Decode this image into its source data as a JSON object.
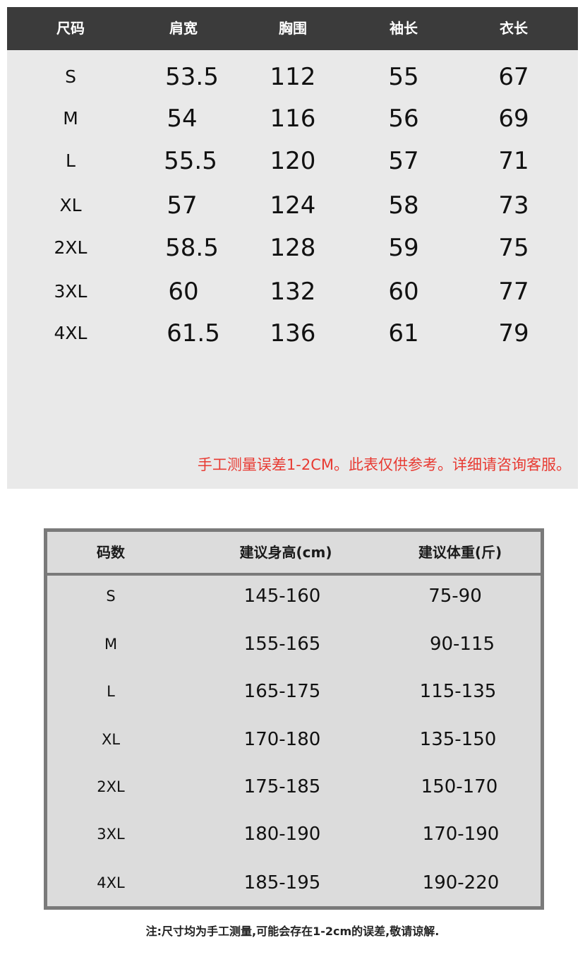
{
  "size_table": {
    "headers": [
      "尺码",
      "肩宽",
      "胸围",
      "袖长",
      "衣长"
    ],
    "rows": [
      [
        "S",
        "53.5",
        "112",
        "55",
        "67"
      ],
      [
        "M",
        "54",
        "116",
        "56",
        "69"
      ],
      [
        "L",
        "55.5",
        "120",
        "57",
        "71"
      ],
      [
        "XL",
        "57",
        "124",
        "58",
        "73"
      ],
      [
        "2XL",
        "58.5",
        "128",
        "59",
        "75"
      ],
      [
        "3XL",
        "60",
        "132",
        "60",
        "77"
      ],
      [
        "4XL",
        "61.5",
        "136",
        "61",
        "79"
      ]
    ],
    "note": "手工测量误差1-2CM。此表仅供参考。详细请咨询客服。",
    "header_bg": "#3b3b3b",
    "note_color": "#e83a32"
  },
  "recommend_table": {
    "headers": [
      "码数",
      "建议身高(cm)",
      "建议体重(斤)"
    ],
    "rows": [
      [
        "S",
        "145-160",
        "75-90"
      ],
      [
        "M",
        "155-165",
        "90-115"
      ],
      [
        "L",
        "165-175",
        "115-135"
      ],
      [
        "XL",
        "170-180",
        "135-150"
      ],
      [
        "2XL",
        "175-185",
        "150-170"
      ],
      [
        "3XL",
        "180-190",
        "170-190"
      ],
      [
        "4XL",
        "185-195",
        "190-220"
      ]
    ]
  },
  "footnote": "注:尺寸均为手工测量,可能会存在1-2cm的误差,敬请谅解."
}
